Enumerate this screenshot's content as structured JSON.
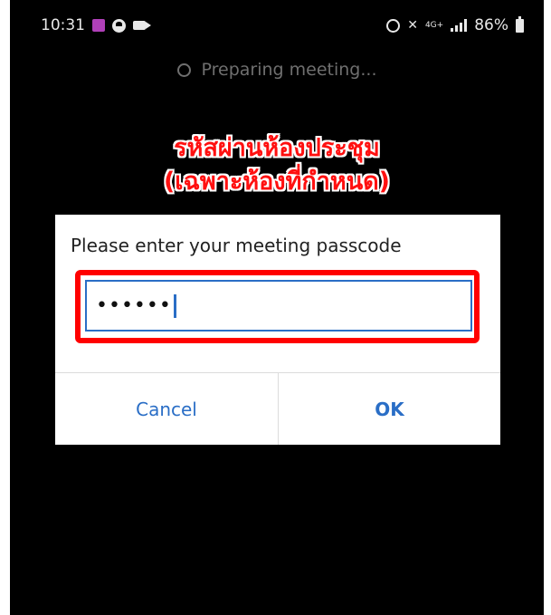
{
  "status_bar": {
    "time": "10:31",
    "network": "4G+",
    "battery": "86%"
  },
  "preparing": {
    "text": "Preparing meeting..."
  },
  "annotation": {
    "line1": "รหัสผ่านห้องประชุม",
    "line2": "(เฉพาะห้องที่กำหนด)",
    "color": "#ff1010"
  },
  "dialog": {
    "title": "Please enter your meeting passcode",
    "passcode_value": "••••••",
    "cancel_label": "Cancel",
    "ok_label": "OK"
  },
  "colors": {
    "accent": "#2a6ec6",
    "highlight": "#ff0000",
    "background": "#000000"
  }
}
